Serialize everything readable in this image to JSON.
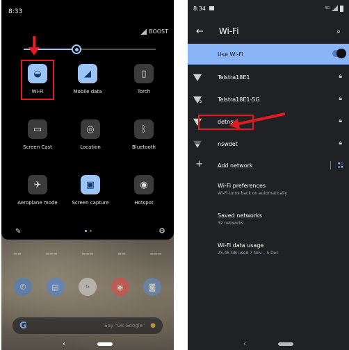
{
  "left_phone": {
    "status_time": "8:33",
    "network_label": "BOOST",
    "brightness_level": 0.4,
    "tiles": [
      {
        "label": "Wi-Fi",
        "icon": "wifi-icon",
        "active": true
      },
      {
        "label": "Mobile data",
        "icon": "mobile-data-icon",
        "active": true
      },
      {
        "label": "Torch",
        "icon": "torch-icon",
        "active": false
      },
      {
        "label": "Screen Cast",
        "icon": "cast-icon",
        "active": false
      },
      {
        "label": "Location",
        "icon": "location-icon",
        "active": false
      },
      {
        "label": "Bluetooth",
        "icon": "bluetooth-icon",
        "active": false
      },
      {
        "label": "Aeroplane mode",
        "icon": "airplane-icon",
        "active": false
      },
      {
        "label": "Screen capture",
        "icon": "screen-capture-icon",
        "active": true
      },
      {
        "label": "Hotspot",
        "icon": "hotspot-icon",
        "active": false
      }
    ],
    "search_hint": "Say \"Ok Google\"",
    "highlight_color": "#e01b22",
    "accent_color": "#9cc5f5"
  },
  "right_phone": {
    "status_time": "8:34",
    "title": "Wi-Fi",
    "use_wifi_label": "Use Wi-Fi",
    "use_wifi_on": true,
    "networks": [
      {
        "name": "Telstra18E1",
        "icon": "wifi-full-icon",
        "locked": true
      },
      {
        "name": "Telstra18E1-5G",
        "icon": "wifi-5g-icon",
        "locked": true
      },
      {
        "name": "detnsw",
        "icon": "wifi-full-icon",
        "locked": true
      },
      {
        "name": "nswdet",
        "icon": "wifi-weak-icon",
        "locked": true
      }
    ],
    "add_network_label": "Add network",
    "preferences": [
      {
        "title": "Wi-Fi preferences",
        "subtitle": "Wi-Fi turns back on automatically"
      },
      {
        "title": "Saved networks",
        "subtitle": "32 networks"
      },
      {
        "title": "Wi-Fi data usage",
        "subtitle": "25.45 GB used 7 Nov – 5 Dec"
      }
    ],
    "accent_color": "#8ab4f8"
  }
}
